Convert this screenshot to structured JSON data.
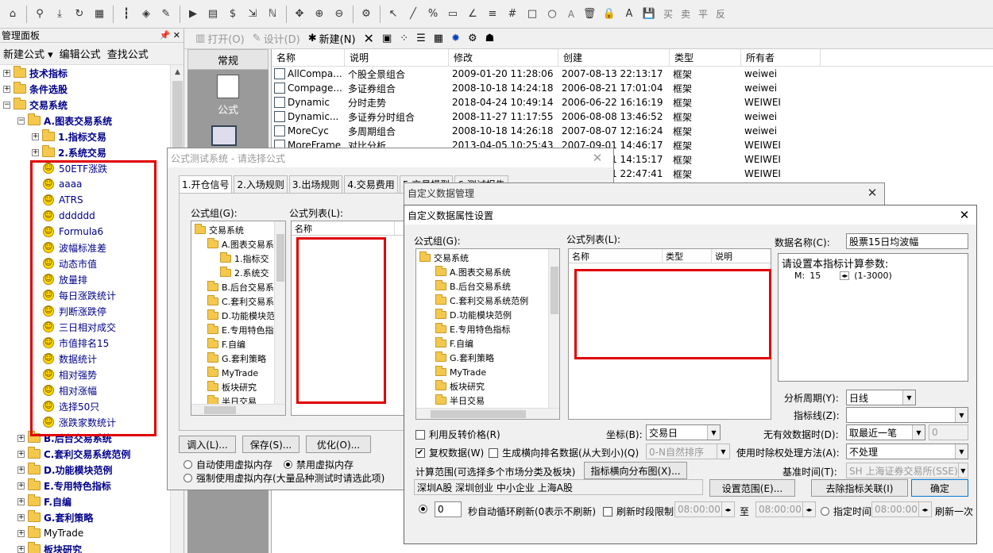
{
  "toolbar": {
    "text_tools": [
      "A",
      "买",
      "卖",
      "平",
      "反"
    ]
  },
  "left_panel": {
    "title": "管理面板",
    "menu": [
      "新建公式 ▾",
      "编辑公式",
      "查找公式"
    ],
    "tree": [
      {
        "label": "技术指标"
      },
      {
        "label": "条件选股"
      },
      {
        "label": "交易系统"
      },
      {
        "label": "A.图表交易系统"
      },
      {
        "label": "1.指标交易"
      },
      {
        "label": "2.系统交易"
      },
      {
        "label": "50ETF涨跌"
      },
      {
        "label": "aaaa"
      },
      {
        "label": "ATRS"
      },
      {
        "label": "dddddd"
      },
      {
        "label": "Formula6"
      },
      {
        "label": "波幅标准差"
      },
      {
        "label": "动态市值"
      },
      {
        "label": "放量排"
      },
      {
        "label": "每日涨跌统计"
      },
      {
        "label": "判断涨跌停"
      },
      {
        "label": "三日相对成交"
      },
      {
        "label": "市值排名15"
      },
      {
        "label": "数据统计"
      },
      {
        "label": "相对强势"
      },
      {
        "label": "相对涨幅"
      },
      {
        "label": "选择50只"
      },
      {
        "label": "涨跌家数统计"
      },
      {
        "label": "B.后台交易系统"
      },
      {
        "label": "C.套利交易系统范例"
      },
      {
        "label": "D.功能模块范例"
      },
      {
        "label": "E.专用特色指标"
      },
      {
        "label": "F.自编"
      },
      {
        "label": "G.套利策略"
      },
      {
        "label": "MyTrade"
      },
      {
        "label": "板块研究"
      }
    ]
  },
  "toolbar2": {
    "open": "打开(O)",
    "design": "设计(D)",
    "new": "新建(N)"
  },
  "category": {
    "head": "常规",
    "formula": "公式"
  },
  "list": {
    "headers": [
      "名称",
      "说明",
      "修改",
      "创建",
      "类型",
      "所有者"
    ],
    "rows": [
      [
        "AllCompa...",
        "个股全景组合",
        "2009-01-20 11:28:06",
        "2007-08-13 22:13:17",
        "框架",
        "weiwei"
      ],
      [
        "Compage...",
        "多证券组合",
        "2008-10-18 14:24:18",
        "2006-08-21 17:01:04",
        "框架",
        "weiwei"
      ],
      [
        "Dynamic",
        "分时走势",
        "2018-04-24 10:49:14",
        "2006-06-22 16:16:19",
        "框架",
        "WEIWEI"
      ],
      [
        "Dynamic...",
        "多证券分时组合",
        "2008-11-27 11:17:55",
        "2006-08-08 13:46:52",
        "框架",
        "weiwei"
      ],
      [
        "MoreCyc",
        "多周期组合",
        "2008-10-18 14:26:18",
        "2007-08-07 12:16:24",
        "框架",
        "weiwei"
      ],
      [
        "MoreFrame",
        "对比分析",
        "2013-04-05 10:25:43",
        "2007-09-01 14:46:17",
        "框架",
        "WEIWEI"
      ],
      [
        "",
        "",
        "",
        "2007-09-01 14:15:17",
        "框架",
        "WEIWEI"
      ],
      [
        "",
        "",
        "",
        "2007-09-01 22:47:41",
        "框架",
        "WEIWEI"
      ]
    ]
  },
  "dlg1": {
    "title": "公式测试系统 - 请选择公式",
    "tabs": [
      "1.开仓信号",
      "2.入场规则",
      "3.出场规则",
      "4.交易费用",
      "5.交易模型",
      "6.测试报告"
    ],
    "group_label": "公式组(G):",
    "list_label": "公式列表(L):",
    "list_col": "名称",
    "tree": [
      "交易系统",
      "A.图表交易系",
      "1.指标交",
      "2.系统交",
      "B.后台交易系",
      "C.套利交易系",
      "D.功能模块范",
      "E.专用特色指",
      "F.自编",
      "G.套利策略",
      "MyTrade",
      "板块研究",
      "半日交易"
    ],
    "buttons": [
      "调入(L)...",
      "保存(S)...",
      "优化(O)..."
    ],
    "radio1": "自动使用虚拟内存",
    "radio2": "禁用虚拟内存",
    "radio3": "强制使用虚拟内存(大量品种测试时请选此项)"
  },
  "dlg2": {
    "title": "自定义数据管理"
  },
  "dlg3": {
    "title": "自定义数据属性设置",
    "group_label": "公式组(G):",
    "list_label": "公式列表(L):",
    "list_cols": [
      "名称",
      "类型",
      "说明"
    ],
    "tree": [
      "交易系统",
      "A.图表交易系统",
      "B.后台交易系统",
      "C.套利交易系统范例",
      "D.功能模块范例",
      "E.专用特色指标",
      "F.自编",
      "G.套利策略",
      "MyTrade",
      "板块研究",
      "半日交易"
    ],
    "data_name_label": "数据名称(C):",
    "data_name_value": "股票15日均波幅",
    "param_title": "请设置本指标计算参数:",
    "param_name": "M:",
    "param_value": "15",
    "param_range": "(1-3000)",
    "period_label": "分析周期(Y):",
    "period_value": "日线",
    "indicator_label": "指标线(Z):",
    "indicator_value": "",
    "use_reverse": "利用反转价格(R)",
    "coord_label": "坐标(B):",
    "coord_value": "交易日",
    "no_data_label": "无有效数据时(D):",
    "no_data_value": "取最近一笔",
    "no_data_num": "0",
    "fq_label": "复权数据(W)",
    "rank_label": "生成横向排名数据(从大到小)(Q)",
    "rank_value": "0-N自然排序",
    "fq_method_label": "使用时除权处理方法(A):",
    "fq_method_value": "不处理",
    "base_time_label": "基准时间(T):",
    "base_time_value": "SH 上海证券交易所(SSE)",
    "calc_range_label": "计算范围(可选择多个市场分类及板块)",
    "dist_button": "指标横向分布图(X)...",
    "markets": "深圳A股  深圳创业  中小企业  上海A股",
    "set_range_button": "设置范围(E)...",
    "remove_button": "去除指标关联(I)",
    "ok_button": "确定",
    "refresh_value": "0",
    "refresh_label": "秒自动循环刷新(0表示不刷新)",
    "period_limit_label": "刷新时段限制",
    "time_from": "08:00:00",
    "to": "至",
    "time_to": "08:00:00",
    "spec_time_label": "指定时间",
    "spec_time": "08:00:00",
    "refresh_once": "刷新一次"
  }
}
